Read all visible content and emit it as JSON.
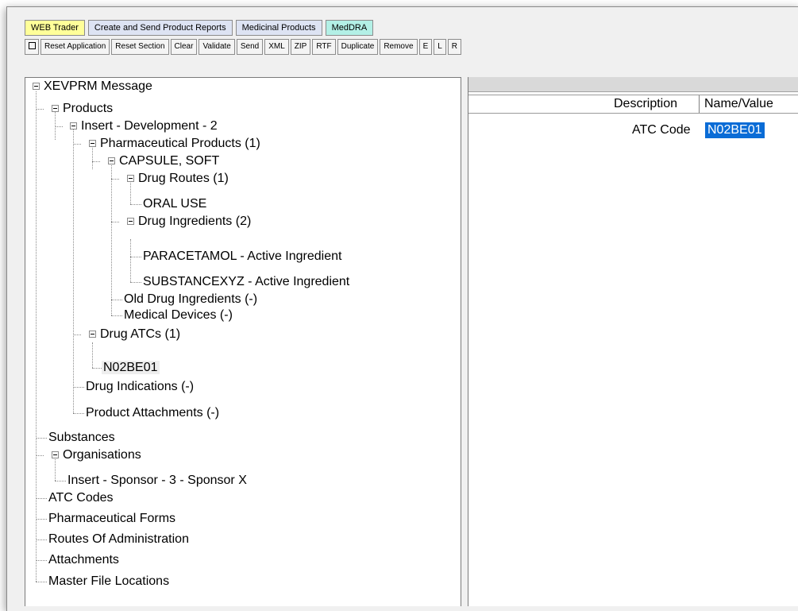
{
  "tabs": [
    "WEB Trader",
    "Create and Send Product Reports",
    "Medicinal Products",
    "MedDRA"
  ],
  "toolbar": {
    "box_icon": "square-icon",
    "buttons": [
      "Reset Application",
      "Reset Section",
      "Clear",
      "Validate",
      "Send",
      "XML",
      "ZIP",
      "RTF",
      "Duplicate",
      "Remove",
      "E",
      "L",
      "R"
    ]
  },
  "tree": {
    "root": "XEVPRM Message",
    "products": "Products",
    "insert_dev": "Insert - Development - 2",
    "pharma_products": "Pharmaceutical Products (1)",
    "capsule": "CAPSULE, SOFT",
    "drug_routes": "Drug Routes (1)",
    "oral_use": "ORAL USE",
    "drug_ingredients": "Drug Ingredients (2)",
    "paracetamol": "PARACETAMOL - Active Ingredient",
    "substancexyz": "SUBSTANCEXYZ - Active Ingredient",
    "old_drug_ingredients": "Old Drug Ingredients (-)",
    "medical_devices": "Medical Devices (-)",
    "drug_atcs": "Drug ATCs (1)",
    "n02be01": "N02BE01",
    "drug_indications": "Drug Indications (-)",
    "product_attachments": "Product Attachments (-)",
    "substances": "Substances",
    "organisations": "Organisations",
    "insert_sponsor": "Insert - Sponsor - 3 - Sponsor X",
    "atc_codes": "ATC Codes",
    "pharma_forms": "Pharmaceutical Forms",
    "routes_admin": "Routes Of Administration",
    "attachments": "Attachments",
    "master_file_locations": "Master File Locations"
  },
  "properties": {
    "headers": {
      "description": "Description",
      "name_value": "Name/Value"
    },
    "rows": [
      {
        "description": "ATC Code",
        "value": "N02BE01"
      }
    ]
  },
  "colors": {
    "tab_web": "#ffff99",
    "tab_create": "#dde3f3",
    "tab_meddra": "#b3f0e6",
    "selection": "#0a6cd6"
  }
}
